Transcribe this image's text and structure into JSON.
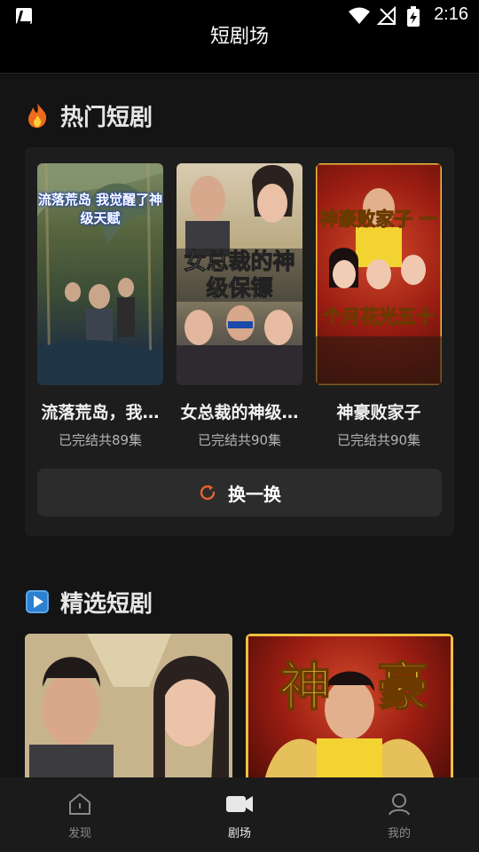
{
  "status_bar": {
    "time": "2:16"
  },
  "header": {
    "title": "短剧场"
  },
  "hot_section": {
    "title": "热门短剧",
    "icon": "fire-icon",
    "dramas": [
      {
        "name": "流落荒岛，我…",
        "status": "已完结共89集",
        "poster_text": "流落荒岛 我觉醒了神级天赋"
      },
      {
        "name": "女总裁的神级…",
        "status": "已完结共90集",
        "poster_text": "女总裁的神级保镖"
      },
      {
        "name": "神豪败家子",
        "status": "已完结共90集",
        "poster_text": "神豪败家子 一个月花光五十亿"
      }
    ],
    "refresh_label": "换一换"
  },
  "featured_section": {
    "title": "精选短剧",
    "icon": "play-icon"
  },
  "bottom_nav": {
    "items": [
      {
        "label": "发现",
        "icon": "discover-icon",
        "active": false
      },
      {
        "label": "剧场",
        "icon": "video-icon",
        "active": true
      },
      {
        "label": "我的",
        "icon": "profile-icon",
        "active": false
      }
    ]
  },
  "colors": {
    "accent": "#e7642d",
    "background": "#141414",
    "panel": "#1d1d1d"
  }
}
